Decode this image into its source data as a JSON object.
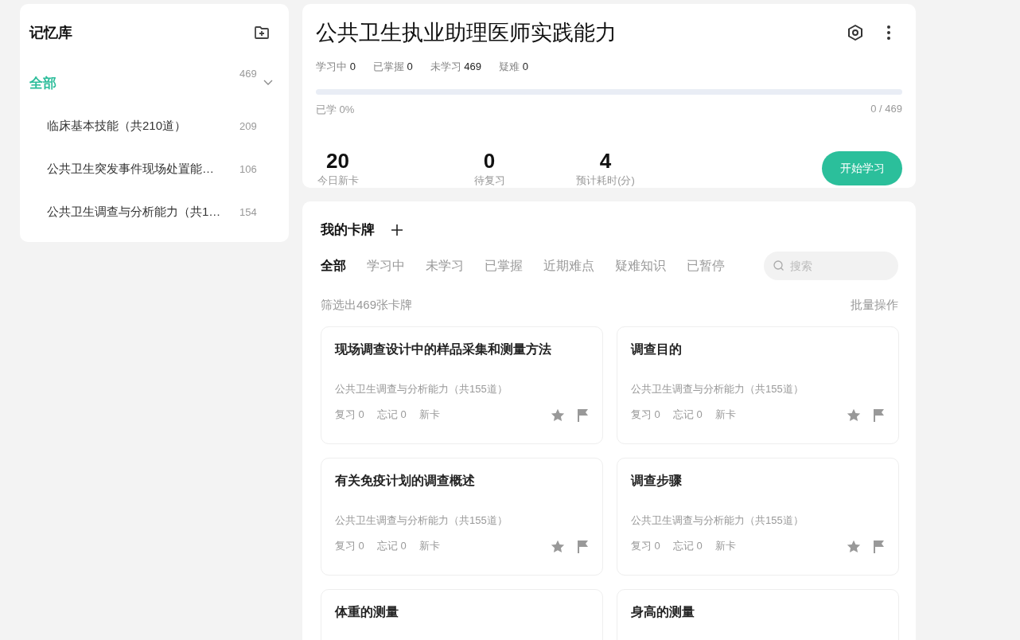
{
  "library": {
    "title": "记忆库",
    "all": {
      "label": "全部",
      "count": "469",
      "expanded": true,
      "selected": true
    },
    "items": [
      {
        "label": "临床基本技能（共210道）",
        "count": "209",
        "selected": false
      },
      {
        "label": "公共卫生突发事件现场处置能…",
        "count": "106",
        "selected": false
      },
      {
        "label": "公共卫生调查与分析能力（共1…",
        "count": "154",
        "selected": false
      }
    ]
  },
  "deck": {
    "title": "公共卫生执业助理医师实践能力",
    "stats": [
      {
        "label": "学习中",
        "value": "0"
      },
      {
        "label": "已掌握",
        "value": "0"
      },
      {
        "label": "未学习",
        "value": "469"
      },
      {
        "label": "疑难",
        "value": "0"
      }
    ],
    "progress": {
      "level": 0,
      "label": "已学 0%",
      "count": "0 / 469"
    },
    "today": [
      {
        "value": "20",
        "label": "今日新卡"
      },
      {
        "value": "0",
        "label": "待复习"
      },
      {
        "value": "4",
        "label": "预计耗时(分)"
      }
    ],
    "start_button": "开始学习"
  },
  "cards": {
    "title": "我的卡牌",
    "tabs": [
      {
        "label": "全部",
        "selected": true
      },
      {
        "label": "学习中",
        "selected": false
      },
      {
        "label": "未学习",
        "selected": false
      },
      {
        "label": "已掌握",
        "selected": false
      },
      {
        "label": "近期难点",
        "selected": false
      },
      {
        "label": "疑难知识",
        "selected": false
      },
      {
        "label": "已暂停",
        "selected": false
      }
    ],
    "search": {
      "placeholder": "搜索"
    },
    "summary": "筛选出469张卡牌",
    "batch": "批量操作",
    "items": [
      {
        "title": "现场调查设计中的样品采集和测量方法",
        "deck": "公共卫生调查与分析能力（共155道）",
        "review": "复习 0",
        "forget": "忘记 0",
        "status": "新卡"
      },
      {
        "title": "调查目的",
        "deck": "公共卫生调查与分析能力（共155道）",
        "review": "复习 0",
        "forget": "忘记 0",
        "status": "新卡"
      },
      {
        "title": "有关免疫计划的调查概述",
        "deck": "公共卫生调查与分析能力（共155道）",
        "review": "复习 0",
        "forget": "忘记 0",
        "status": "新卡"
      },
      {
        "title": "调查步骤",
        "deck": "公共卫生调查与分析能力（共155道）",
        "review": "复习 0",
        "forget": "忘记 0",
        "status": "新卡"
      },
      {
        "title": "体重的测量"
      },
      {
        "title": "身高的测量"
      }
    ]
  }
}
